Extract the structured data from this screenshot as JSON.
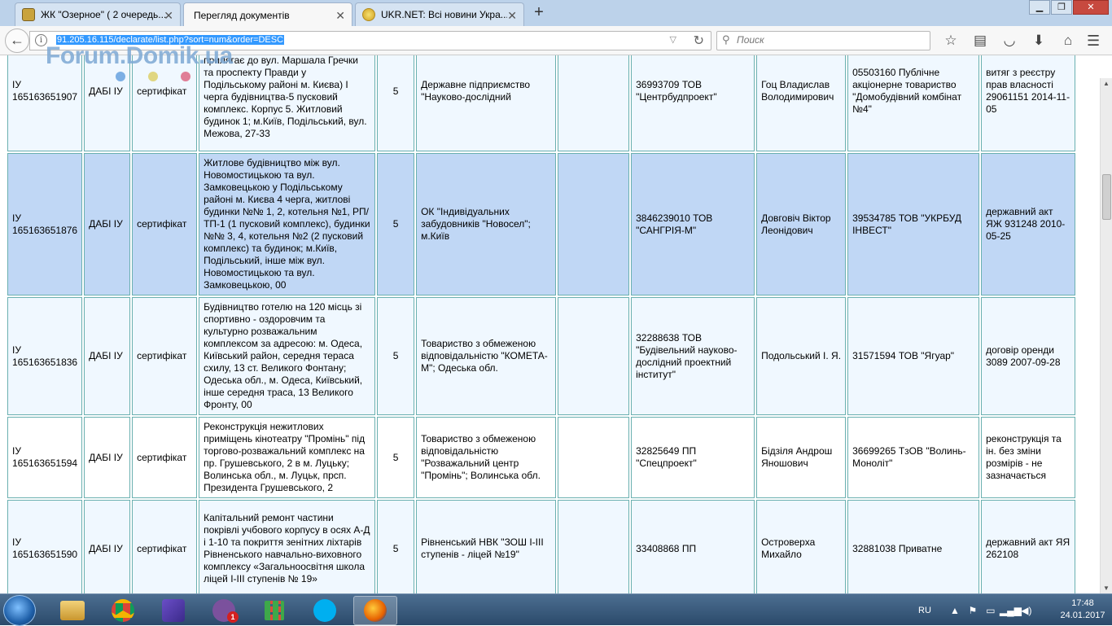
{
  "browser": {
    "tabs": [
      {
        "title": "ЖК \"Озерное\" ( 2 очередь...",
        "active": false
      },
      {
        "title": "Перегляд документів",
        "active": true
      },
      {
        "title": "UKR.NET: Всі новини Укра...",
        "active": false
      }
    ],
    "new_tab": "+",
    "url": "91.205.16.115/declarate/list.php?sort=num&order=DESC",
    "search_placeholder": "Поиск"
  },
  "watermark": "Forum.Domik.ua",
  "table": {
    "rows": [
      {
        "id": "ІУ 165163651907",
        "authority": "ДАБІ ІУ",
        "doc_type": "сертифікат",
        "object": "районі (місце розташування: прилягає до вул. Маршала Гречки та проспекту Правди у Подільському районі м. Києва) I черга будівництва-5 пусковий комплекс. Корпус 5. Житловий будинок 1; м.Київ, Подільський, вул. Межова, 27-33",
        "category": "5",
        "customer": "Державне підприємство \"Науково-дослідний",
        "contractor": "",
        "designer": "36993709 ТОВ \"Центрбудпроект\"",
        "supervisor": "Гоц Владислав Володимирович",
        "builder": "05503160 Публічне акціонерне товариство \"Домобудівний комбінат №4\"",
        "land_doc": "витяг з реєстру прав власності 29061151 2014-11-05"
      },
      {
        "id": "ІУ 165163651876",
        "authority": "ДАБІ ІУ",
        "doc_type": "сертифікат",
        "object": "Житлове будівництво між вул. Новомостицькою та вул. Замковецькою у Подільському районі м. Києва 4 черга, житлові будинки №№ 1, 2, котельня №1, РП/ТП-1 (1 пусковий комплекс), будинки №№ 3, 4, котельня №2 (2 пусковий комплекс) та будинок; м.Київ, Подільський, інше між вул. Новомостицькою та вул. Замковецькою, 00",
        "category": "5",
        "customer": "ОК \"Індивідуальних забудовників \"Новосел\"; м.Київ",
        "contractor": "",
        "designer": "3846239010 ТОВ \"САНГРІЯ-М\"",
        "supervisor": "Довговіч Віктор Леонідович",
        "builder": "39534785 ТОВ \"УКРБУД ІНВЕСТ\"",
        "land_doc": "державний акт ЯЖ 931248 2010-05-25"
      },
      {
        "id": "ІУ 165163651836",
        "authority": "ДАБІ ІУ",
        "doc_type": "сертифікат",
        "object": "Будівництво готелю на 120 місць зі спортивно - оздоровчим та культурно розважальним комплексом за адресою: м. Одеса, Київський район, середня тераса схилу, 13 ст. Великого Фонтану; Одеська обл., м. Одеса, Київський, інше середня траса, 13 Великого Фронту, 00",
        "category": "5",
        "customer": "Товариство з обмеженою відповідальністю \"КОМЕТА-М\"; Одеська обл.",
        "contractor": "",
        "designer": "32288638 ТОВ \"Будівельний науково-дослідний проектний інститут\"",
        "supervisor": "Подольський І. Я.",
        "builder": "31571594 ТОВ \"Ягуар\"",
        "land_doc": "договір оренди 3089 2007-09-28"
      },
      {
        "id": "ІУ 165163651594",
        "authority": "ДАБІ ІУ",
        "doc_type": "сертифікат",
        "object": "Реконструкція нежитлових приміщень кінотеатру \"Промінь\" під торгово-розважальний комплекс на пр. Грушевського, 2 в м. Луцьку; Волинська обл., м. Луцьк, прсп. Президента Грушевського, 2",
        "category": "5",
        "customer": "Товариство з обмеженою відповідальністю \"Розважальний центр \"Промінь\"; Волинська обл.",
        "contractor": "",
        "designer": "32825649 ПП \"Спецпроект\"",
        "supervisor": "Бідзіля Андрош Яношович",
        "builder": "36699265 ТзОВ \"Волинь-Моноліт\"",
        "land_doc": "реконструкція та ін. без зміни розмірів - не зазначається"
      },
      {
        "id": "ІУ 165163651590",
        "authority": "ДАБІ ІУ",
        "doc_type": "сертифікат",
        "object": "Капітальний ремонт частини покрівлі учбового корпусу в осях А-Д і 1-10 та покриття зенітних ліхтарів Рівненського навчально-виховного комплексу «Загальноосвітня школа ліцей І-ІІІ ступенів № 19»",
        "category": "5",
        "customer": "Рівненський НВК \"ЗОШ І-ІІІ ступенів - ліцей №19\"",
        "contractor": "",
        "designer": "33408868 ПП",
        "supervisor": "Островерха Михайло",
        "builder": "32881038 Приватне",
        "land_doc": "державний акт ЯЯ 262108"
      }
    ]
  },
  "taskbar": {
    "viber_badge": "1",
    "language": "RU",
    "time": "17:48",
    "date": "24.01.2017"
  },
  "colors": {
    "selected_row": "#c0d7f5",
    "cell_border": "#6ab0b0",
    "tab_bg": "#bcd2ea"
  }
}
